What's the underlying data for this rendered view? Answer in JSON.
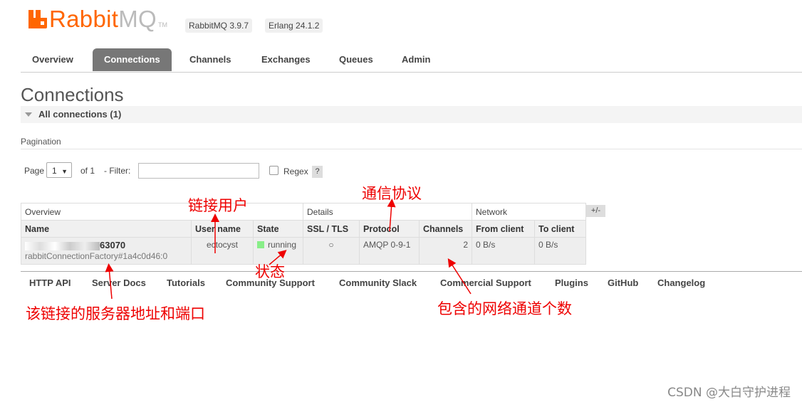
{
  "app": {
    "logo_rabbit": "Rabbit",
    "logo_mq": "MQ",
    "logo_tm": "TM",
    "rabbitmq_version": "RabbitMQ 3.9.7",
    "erlang_version": "Erlang 24.1.2",
    "brand_color": "#ff6600"
  },
  "tabs": [
    {
      "label": "Overview",
      "active": false
    },
    {
      "label": "Connections",
      "active": true
    },
    {
      "label": "Channels",
      "active": false
    },
    {
      "label": "Exchanges",
      "active": false
    },
    {
      "label": "Queues",
      "active": false
    },
    {
      "label": "Admin",
      "active": false
    }
  ],
  "page": {
    "title": "Connections",
    "section_label": "All connections (1)"
  },
  "pagination": {
    "heading": "Pagination",
    "page_label": "Page",
    "page_value": "1",
    "of_label": "of 1",
    "filter_label": "- Filter:",
    "filter_value": "",
    "regex_label": "Regex",
    "regex_checked": false,
    "help_label": "?"
  },
  "table": {
    "groups": [
      "Overview",
      "Details",
      "Network"
    ],
    "columns_toggle": "+/-",
    "headers": [
      "Name",
      "User name",
      "State",
      "SSL / TLS",
      "Protocol",
      "Channels",
      "From client",
      "To client"
    ],
    "rows": [
      {
        "name": "63070",
        "name_sub": "rabbitConnectionFactory#1a4c0d46:0",
        "user": "ectocyst",
        "state": "running",
        "ssl": "○",
        "protocol": "AMQP 0-9-1",
        "channels": "2",
        "from_client": "0 B/s",
        "to_client": "0 B/s"
      }
    ]
  },
  "footer_links": [
    "HTTP API",
    "Server Docs",
    "Tutorials",
    "Community Support",
    "Community Slack",
    "Commercial Support",
    "Plugins",
    "GitHub",
    "Changelog"
  ],
  "annotations": {
    "user": "链接用户",
    "protocol": "通信协议",
    "state": "状态",
    "server_addr": "该链接的服务器地址和端口",
    "channels": "包含的网络通道个数"
  },
  "watermark": "CSDN @大白守护进程"
}
